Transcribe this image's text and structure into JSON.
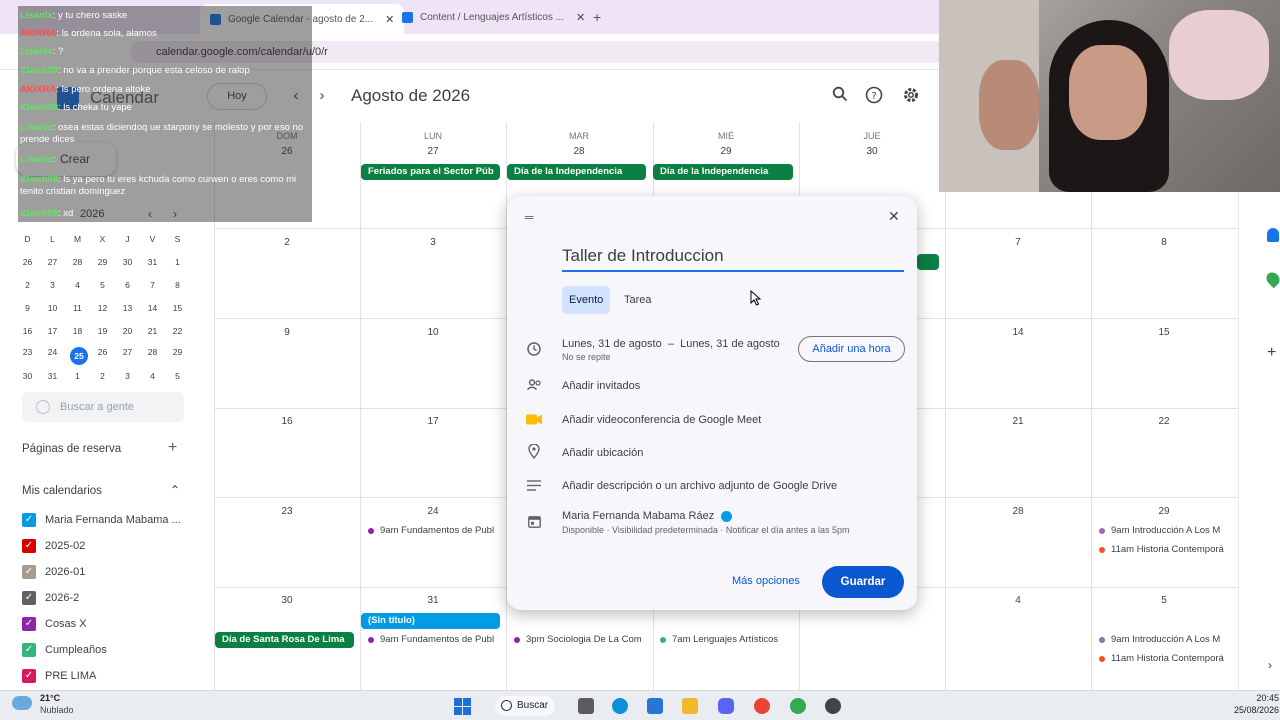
{
  "browser": {
    "tabs": [
      {
        "label": "Google Calendar - agosto de 2...",
        "color": "#1a73e8"
      },
      {
        "label": "Content / Lenguajes Artísticos ...",
        "color": "#1a73e8"
      }
    ],
    "url": "calendar.google.com/calendar/u/0/r",
    "new_tab": "+"
  },
  "header": {
    "app_name": "Calendar",
    "today_label": "Hoy",
    "title": "Agosto de 2026",
    "create_label": "Crear"
  },
  "mini_calendar": {
    "month": "2026",
    "weekdays": [
      "D",
      "L",
      "M",
      "X",
      "J",
      "V",
      "S"
    ],
    "weeks": [
      [
        "26",
        "27",
        "28",
        "29",
        "30",
        "31",
        "1"
      ],
      [
        "2",
        "3",
        "4",
        "5",
        "6",
        "7",
        "8"
      ],
      [
        "9",
        "10",
        "11",
        "12",
        "13",
        "14",
        "15"
      ],
      [
        "16",
        "17",
        "18",
        "19",
        "20",
        "21",
        "22"
      ],
      [
        "23",
        "24",
        "25",
        "26",
        "27",
        "28",
        "29"
      ],
      [
        "30",
        "31",
        "1",
        "2",
        "3",
        "4",
        "5"
      ]
    ],
    "today": "25"
  },
  "sidebar": {
    "people_search": "Buscar a gente",
    "booking_pages": "Páginas de reserva",
    "my_calendars": "Mis calendarios",
    "calendars": [
      {
        "name": "Maria Fernanda Mabama ...",
        "color": "#039be5"
      },
      {
        "name": "2025-02",
        "color": "#d50000"
      },
      {
        "name": "2026-01",
        "color": "#a79b8e"
      },
      {
        "name": "2026-2",
        "color": "#616161"
      },
      {
        "name": "Cosas X",
        "color": "#8e24aa"
      },
      {
        "name": "Cumpleaños",
        "color": "#33b679"
      },
      {
        "name": "PRE LIMA",
        "color": "#d81b60"
      }
    ]
  },
  "grid": {
    "day_names": [
      "DOM",
      "LUN",
      "MAR",
      "MIÉ",
      "JUE",
      "",
      ""
    ],
    "weeks": [
      [
        "26",
        "27",
        "28",
        "29",
        "30",
        "",
        ""
      ],
      [
        "2",
        "3",
        "",
        "",
        "",
        "7",
        "8"
      ],
      [
        "9",
        "10",
        "",
        "",
        "",
        "14",
        "15"
      ],
      [
        "16",
        "17",
        "",
        "",
        "",
        "21",
        "22"
      ],
      [
        "23",
        "24",
        "",
        "",
        "",
        "28",
        "29"
      ],
      [
        "30",
        "31",
        "",
        "",
        "",
        "4",
        "5"
      ]
    ],
    "chips": {
      "feriados": "Feriados para el Sector Púb",
      "independencia1": "Día de la Independencia",
      "independencia2": "Día de la Independencia",
      "santa_rosa": "Día de Santa Rosa De Lima",
      "sin_titulo": "(Sin título)"
    },
    "events": {
      "fundamentos1": "9am Fundamentos de Publ",
      "fundamentos2": "9am Fundamentos de Publ",
      "sociologia": "3pm Sociologia De La Com",
      "lenguajes": "7am Lenguajes Artísticos",
      "intro1": "9am Introducción A Los M",
      "historia1": "11am Historia Contemporá",
      "intro2": "9am Introducción A Los M",
      "historia2": "11am Historia Contemporá"
    },
    "colors": {
      "green": "#0b8043",
      "green_chip": "#33b679",
      "blue_chip": "#039be5",
      "purple": "#8e24aa",
      "orange": "#f4511e",
      "lavender": "#9e69af"
    }
  },
  "dialog": {
    "title": "Taller de Introduccion",
    "tab_event": "Evento",
    "tab_task": "Tarea",
    "date_start": "Lunes, 31 de agosto",
    "date_sep": "–",
    "date_end": "Lunes, 31 de agosto",
    "repeat": "No se repite",
    "add_time": "Añadir una hora",
    "add_guests": "Añadir invitados",
    "add_meet": "Añadir videoconferencia de Google Meet",
    "add_location": "Añadir ubicación",
    "add_description": "Añadir descripción o un archivo adjunto de Google Drive",
    "calendar_owner": "Maria Fernanda Mabama Ráez",
    "calendar_details": "Disponible · Visibilidad predeterminada · Notificar el día antes a las 5pm",
    "more_options": "Más opciones",
    "save": "Guardar"
  },
  "chat": [
    {
      "user": "Lisanlx",
      "color": "#5ee65e",
      "msg": ": y tu chero saske"
    },
    {
      "user": "AKIXRA",
      "color": "#ff4d4d",
      "msg": ": ls ordena sola, alamos"
    },
    {
      "user": "Lisanlx",
      "color": "#5ee65e",
      "msg": ": ?"
    },
    {
      "user": "iDawii08",
      "color": "#5ee65e",
      "msg": ": no va a prender porque esta celoso de ralop"
    },
    {
      "user": "AKIXRA",
      "color": "#ff4d4d",
      "msg": ": ls pero ordena altoke"
    },
    {
      "user": "iDawii08",
      "color": "#5ee65e",
      "msg": ": ls cheka tu yape"
    },
    {
      "user": "Lisanlx",
      "color": "#5ee65e",
      "msg": ": osea estas diciendoq ue starpony se molesto y por eso no prende dices"
    },
    {
      "user": "Lisanlx",
      "color": "#5ee65e",
      "msg": ":"
    },
    {
      "user": "iDawii08",
      "color": "#5ee65e",
      "msg": ": ls ya pero tu eres kchuda como curwen o eres como mi tenito cristian dominguez"
    },
    {
      "user": "iDawii08",
      "color": "#5ee65e",
      "msg": ": xd"
    }
  ],
  "taskbar": {
    "weather_temp": "21°C",
    "weather_desc": "Nublado",
    "search": "Buscar",
    "time": "20:45",
    "date": "25/08/2026"
  }
}
